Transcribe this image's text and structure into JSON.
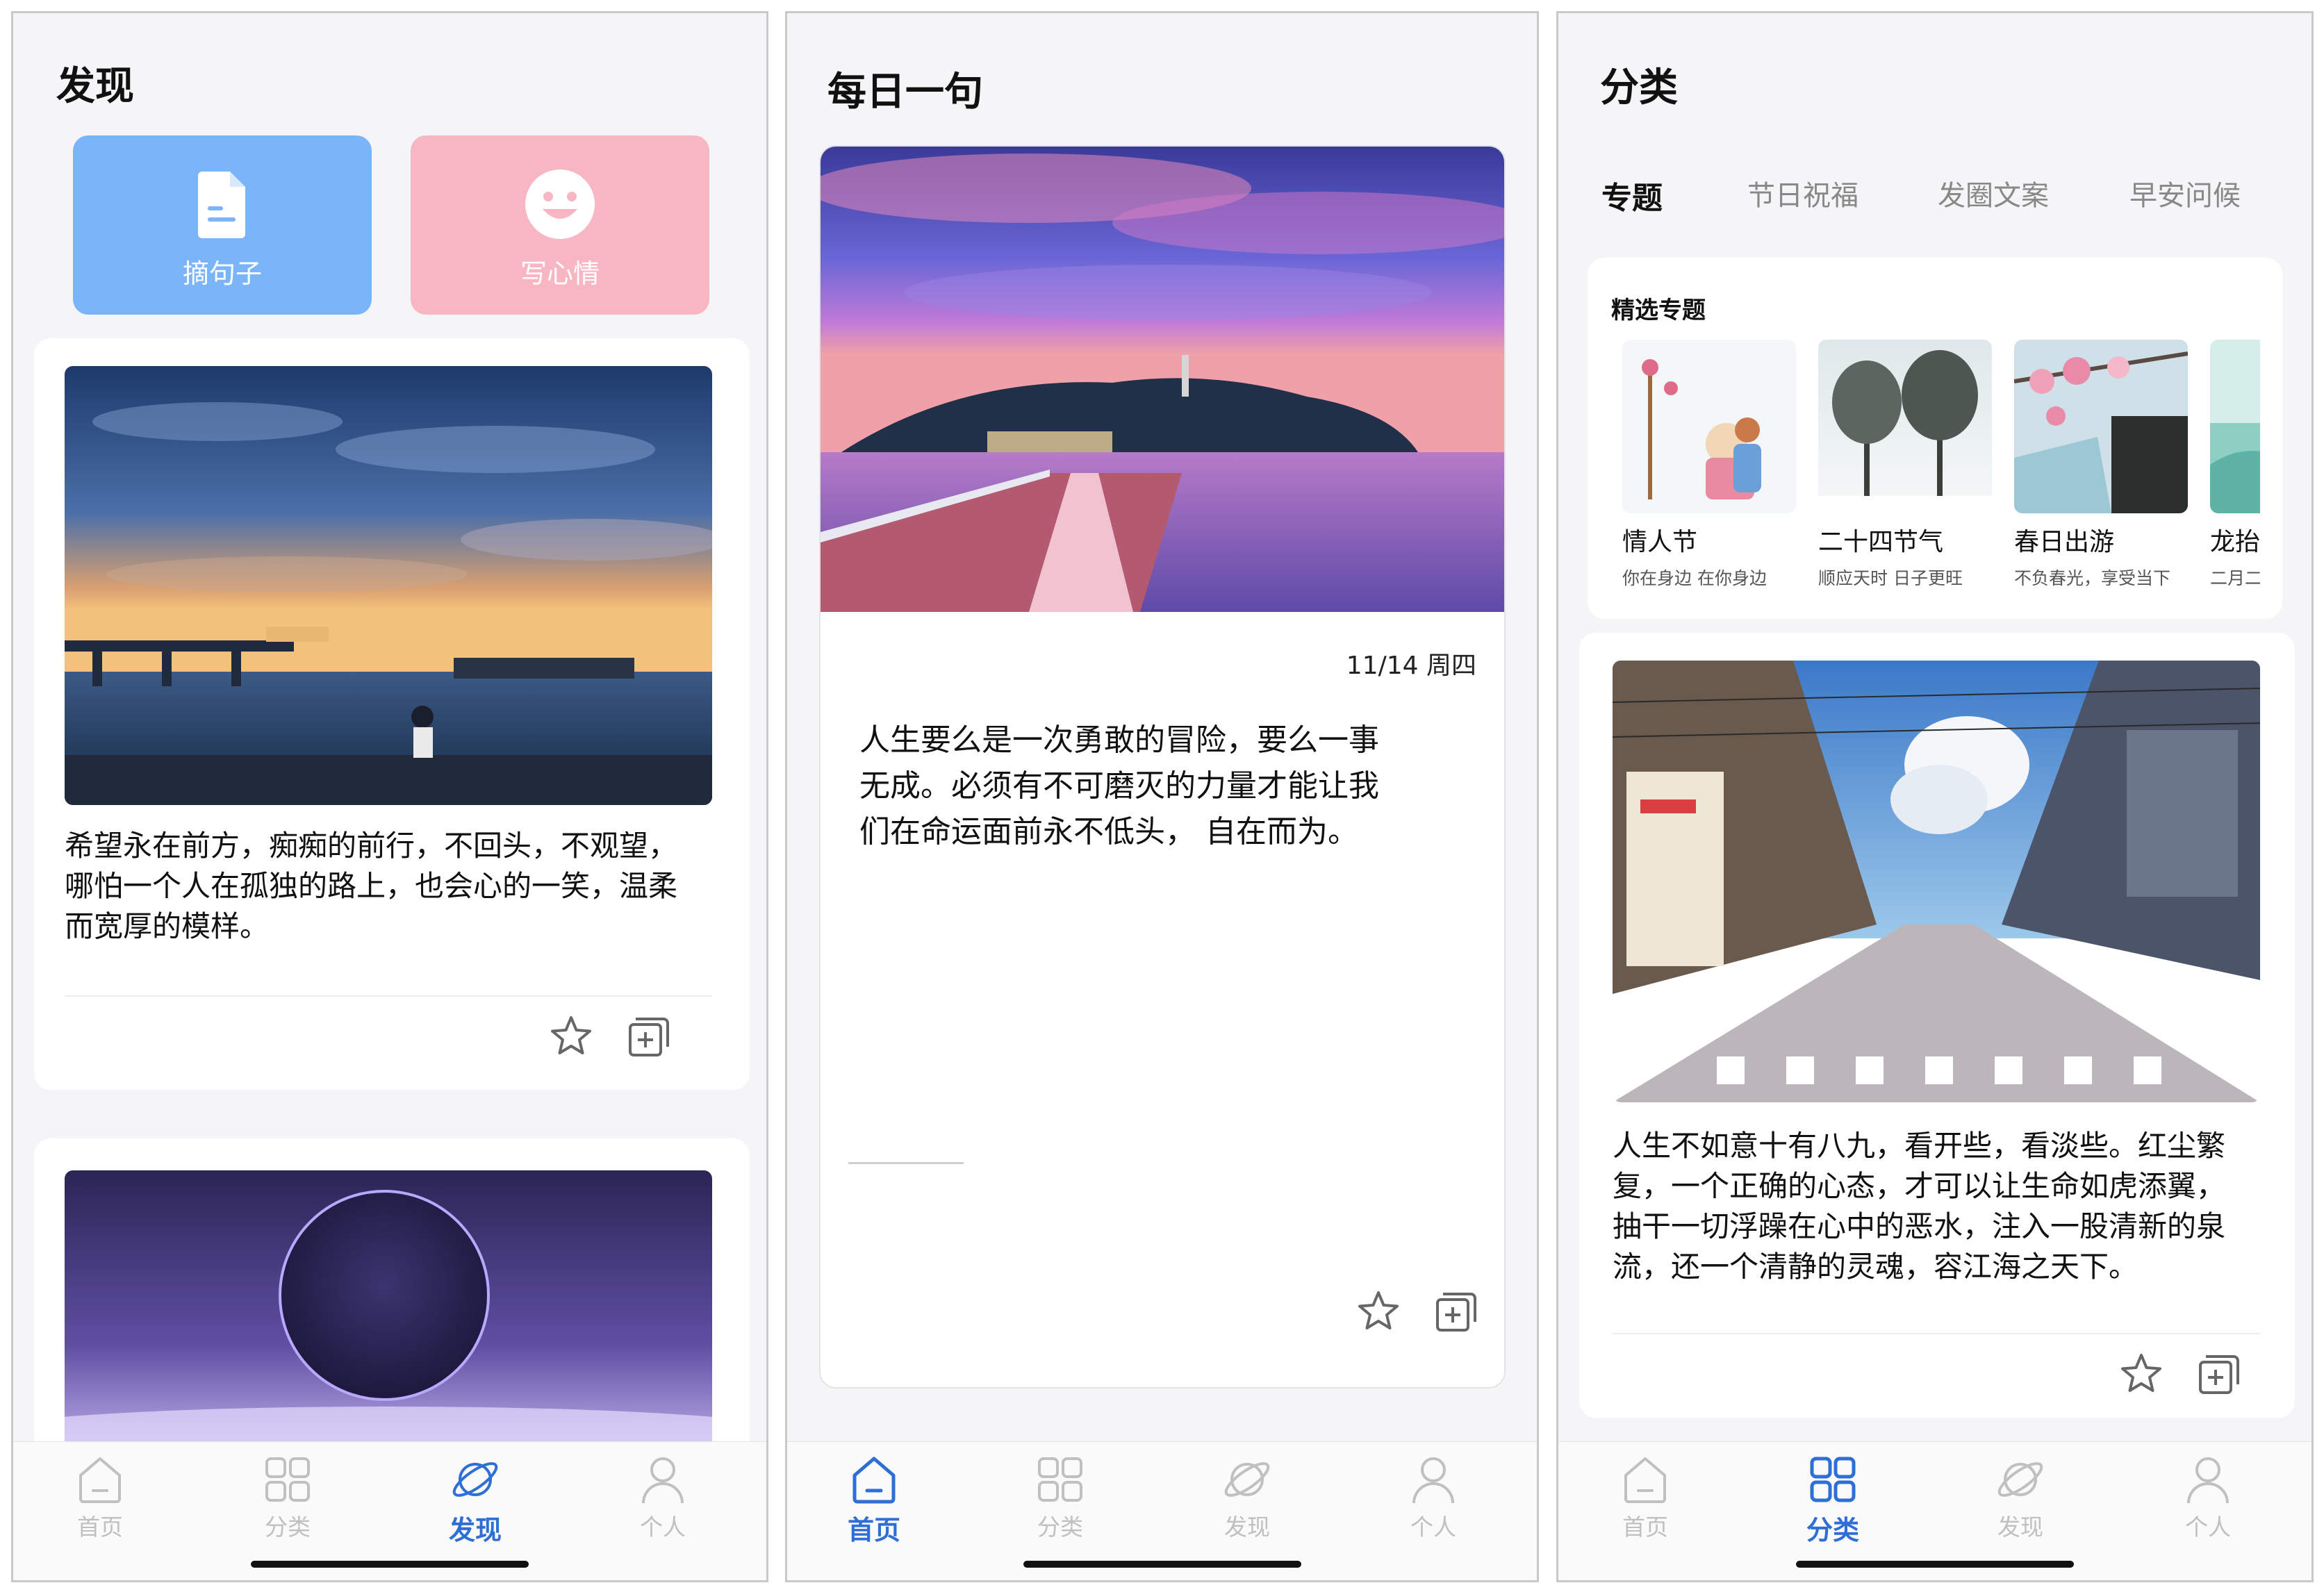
{
  "tabbar": {
    "home": "首页",
    "category": "分类",
    "discover": "发现",
    "profile": "个人"
  },
  "discover_screen": {
    "title": "发现",
    "quick_actions": [
      {
        "label": "摘句子",
        "icon": "document-icon",
        "color": "#7ab4f9"
      },
      {
        "label": "写心情",
        "icon": "smiley-icon",
        "color": "#f8b6c3"
      }
    ],
    "post": {
      "image": "anime-girl-sunset-seaside",
      "text_lines": [
        "希望永在前方，痴痴的前行，不回头，不观望，",
        "哪怕一个人在孤独的路上，也会心的一笑，温柔",
        "而宽厚的模样。"
      ]
    },
    "next_post_image": "purple-planet-horizon",
    "active_tab": "discover"
  },
  "daily_screen": {
    "title": "每日一句",
    "image": "island-bridge-purple-sunset",
    "date": "11/14 周四",
    "text_lines": [
      "人生要么是一次勇敢的冒险，要么一事",
      "无成。必须有不可磨灭的力量才能让我",
      "们在命运面前永不低头， 自在而为。"
    ],
    "active_tab": "home"
  },
  "category_screen": {
    "title": "分类",
    "tabs": [
      "专题",
      "节日祝福",
      "发圈文案",
      "早安问候"
    ],
    "featured_heading": "精选专题",
    "topics": [
      {
        "name": "情人节",
        "desc": "你在身边  在你身边"
      },
      {
        "name": "二十四节气",
        "desc": "顺应天时  日子更旺"
      },
      {
        "name": "春日出游",
        "desc": "不负春光，享受当下"
      },
      {
        "name": "龙抬",
        "desc": "二月二"
      }
    ],
    "post": {
      "image": "anime-street-crosswalk",
      "text_lines": [
        "人生不如意十有八九，看开些，看淡些。红尘繁",
        "复，一个正确的心态，才可以让生命如虎添翼，",
        "抽干一切浮躁在心中的恶水，注入一股清新的泉",
        "流，还一个清静的灵魂，容江海之天下。"
      ]
    },
    "active_tab": "category"
  },
  "colors": {
    "accent": "#2d6fd6",
    "inactive": "#c0c0c0"
  }
}
